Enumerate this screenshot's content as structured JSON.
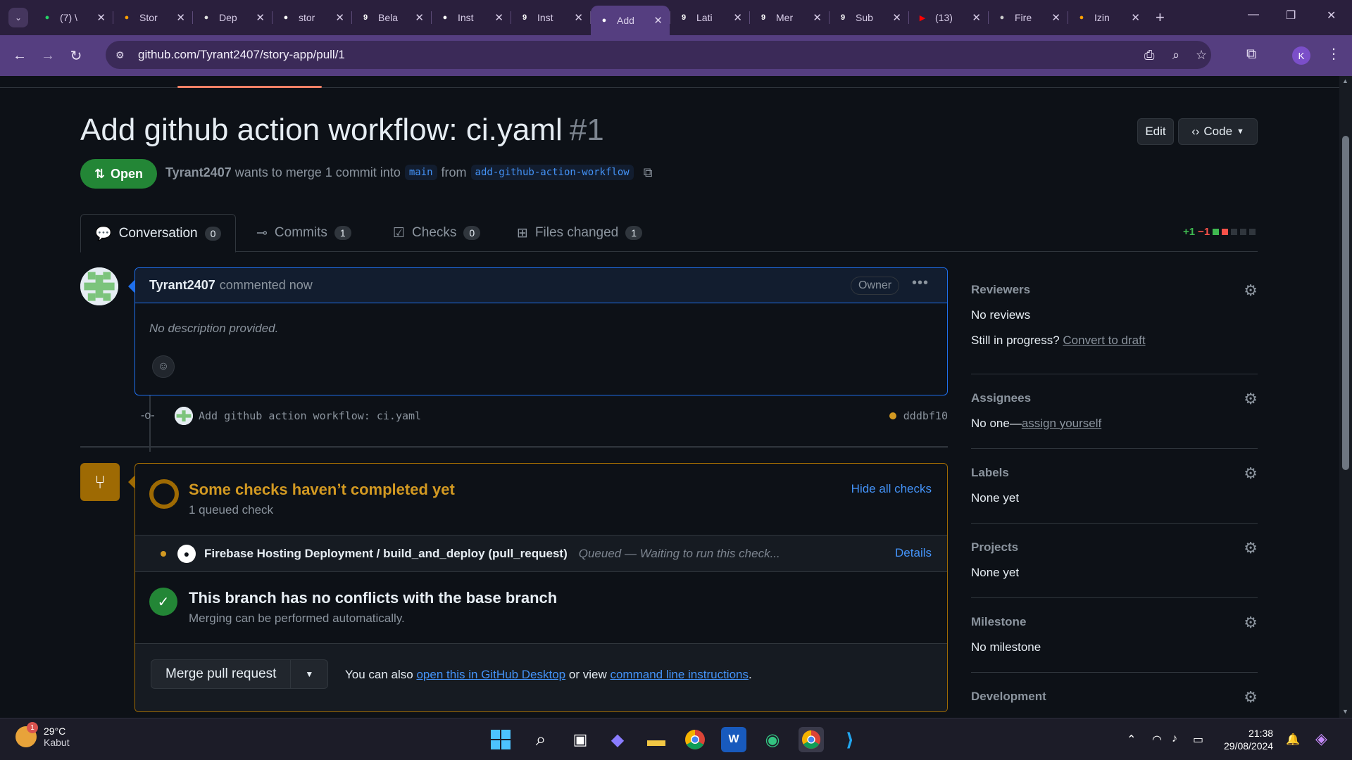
{
  "browser": {
    "tabs": [
      {
        "label": "(7) \\",
        "icon": "whatsapp-icon",
        "color": "#25d366"
      },
      {
        "label": "Stor",
        "icon": "firebase-icon",
        "color": "#ffa000"
      },
      {
        "label": "Dep",
        "icon": "chatgpt-icon",
        "color": "#e0e0e0"
      },
      {
        "label": "stor",
        "icon": "github-icon",
        "color": "#ffffff"
      },
      {
        "label": "Bela",
        "icon": "9-icon",
        "color": "#ffffff"
      },
      {
        "label": "Inst",
        "icon": "github-icon",
        "color": "#ffffff"
      },
      {
        "label": "Inst",
        "icon": "9-icon",
        "color": "#ffffff"
      },
      {
        "label": "Add",
        "icon": "github-icon",
        "color": "#ffffff",
        "active": true
      },
      {
        "label": "Lati",
        "icon": "9-icon",
        "color": "#ffffff"
      },
      {
        "label": "Mer",
        "icon": "9-icon",
        "color": "#ffffff"
      },
      {
        "label": "Sub",
        "icon": "9-icon",
        "color": "#ffffff"
      },
      {
        "label": "(13)",
        "icon": "youtube-icon",
        "color": "#ff0000"
      },
      {
        "label": "Fire",
        "icon": "globe-icon",
        "color": "#cccccc"
      },
      {
        "label": "Izin",
        "icon": "firebase-icon",
        "color": "#ffa000"
      }
    ],
    "url": "github.com/Tyrant2407/story-app/pull/1",
    "profile_initial": "K"
  },
  "pr": {
    "title": "Add github action workflow: ci.yaml",
    "number": "#1",
    "edit_label": "Edit",
    "code_label": "Code",
    "state": "Open",
    "author": "Tyrant2407",
    "merge_text_1": "wants to merge 1 commit into",
    "base_branch": "main",
    "merge_text_2": "from",
    "head_branch": "add-github-action-workflow"
  },
  "tabs": {
    "conversation": {
      "label": "Conversation",
      "count": "0"
    },
    "commits": {
      "label": "Commits",
      "count": "1"
    },
    "checks": {
      "label": "Checks",
      "count": "0"
    },
    "files": {
      "label": "Files changed",
      "count": "1"
    }
  },
  "diffstat": {
    "additions": "+1",
    "deletions": "−1"
  },
  "comment": {
    "author": "Tyrant2407",
    "time": "commented now",
    "role": "Owner",
    "body": "No description provided."
  },
  "commit": {
    "message": "Add github action workflow: ci.yaml",
    "sha": "dddbf10"
  },
  "checks": {
    "title": "Some checks haven’t completed yet",
    "subtitle": "1 queued check",
    "hide_label": "Hide all checks",
    "check_name": "Firebase Hosting Deployment / build_and_deploy (pull_request)",
    "check_status": "Queued — Waiting to run this check...",
    "details_label": "Details"
  },
  "conflicts": {
    "title": "This branch has no conflicts with the base branch",
    "subtitle": "Merging can be performed automatically."
  },
  "merge": {
    "button_label": "Merge pull request",
    "hint_prefix": "You can also",
    "desktop_link": "open this in GitHub Desktop",
    "hint_mid": "or view",
    "cli_link": "command line instructions",
    "hint_suffix": "."
  },
  "sidebar": {
    "reviewers": {
      "title": "Reviewers",
      "value": "No reviews",
      "draft_prefix": "Still in progress?",
      "draft_link": "Convert to draft"
    },
    "assignees": {
      "title": "Assignees",
      "value_prefix": "No one—",
      "value_link": "assign yourself"
    },
    "labels": {
      "title": "Labels",
      "value": "None yet"
    },
    "projects": {
      "title": "Projects",
      "value": "None yet"
    },
    "milestone": {
      "title": "Milestone",
      "value": "No milestone"
    },
    "development": {
      "title": "Development"
    }
  },
  "taskbar": {
    "temperature": "29°C",
    "condition": "Kabut",
    "weather_badge": "1",
    "time": "21:38",
    "date": "29/08/2024"
  }
}
